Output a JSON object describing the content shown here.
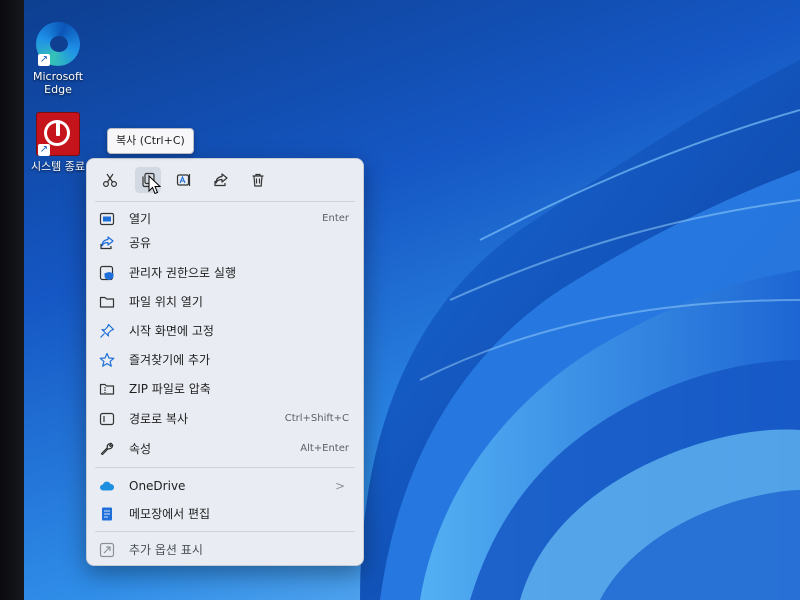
{
  "desktop": {
    "icons": [
      {
        "label": "Microsoft Edge",
        "line1": "Microsoft",
        "line2": "Edge",
        "icon": "edge-icon"
      },
      {
        "label": "시스템 종료",
        "icon": "power-icon"
      }
    ]
  },
  "tooltip": {
    "text": "복사 (Ctrl+C)"
  },
  "context_menu": {
    "toolbar": [
      {
        "icon": "cut-icon",
        "action": "cut"
      },
      {
        "icon": "copy-icon",
        "action": "copy",
        "hovered": true
      },
      {
        "icon": "rename-icon",
        "action": "rename"
      },
      {
        "icon": "share-icon",
        "action": "share"
      },
      {
        "icon": "delete-icon",
        "action": "delete"
      }
    ],
    "items": [
      {
        "label": "열기",
        "shortcut": "Enter",
        "icon": "open-icon"
      },
      {
        "label": "공유",
        "icon": "share-icon"
      },
      {
        "label": "관리자 권한으로 실행",
        "icon": "shield-icon"
      },
      {
        "label": "파일 위치 열기",
        "icon": "folder-icon"
      },
      {
        "label": "시작 화면에 고정",
        "icon": "pin-icon"
      },
      {
        "label": "즐겨찾기에 추가",
        "icon": "star-icon"
      },
      {
        "label": "ZIP 파일로 압축",
        "icon": "zip-folder-icon"
      },
      {
        "label": "경로로 복사",
        "shortcut": "Ctrl+Shift+C",
        "icon": "copy-path-icon"
      },
      {
        "label": "속성",
        "shortcut": "Alt+Enter",
        "icon": "wrench-icon"
      },
      {
        "label": "OneDrive",
        "submenu": ">",
        "icon": "cloud-icon"
      },
      {
        "label": "메모장에서 편집",
        "icon": "notepad-icon"
      },
      {
        "label": "추가 옵션 표시",
        "icon": "more-options-icon"
      }
    ]
  },
  "colors": {
    "accent": "#1e6fd9",
    "menu_bg": "#e9edf3",
    "power_red": "#c5141b"
  }
}
